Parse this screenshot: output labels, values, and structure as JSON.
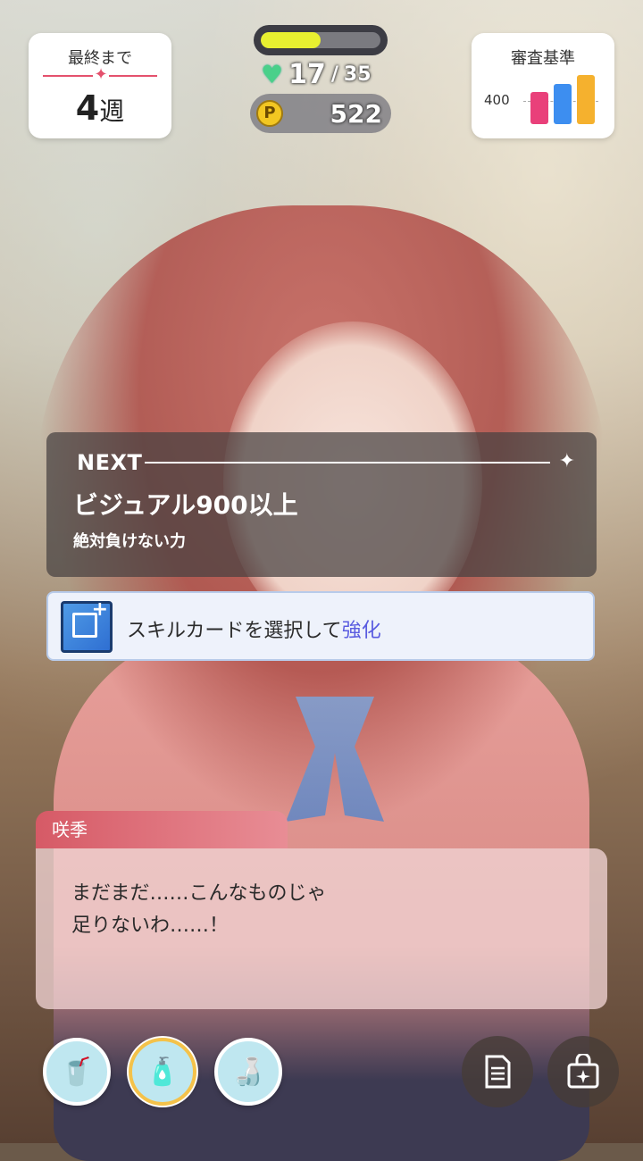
{
  "hud": {
    "weeks_left_label": "最終まで",
    "weeks_left_value": "4",
    "weeks_left_unit": "週",
    "stamina_fill": 0.5,
    "hp_current": "17",
    "hp_max": "35",
    "p_coin_symbol": "P",
    "p_points": "522",
    "criteria_label": "審査基準",
    "criteria_threshold": "400",
    "criteria_bars": [
      {
        "color": "#e9407a",
        "level": 0.62
      },
      {
        "color": "#3d8ef0",
        "level": 0.78
      },
      {
        "color": "#f5b12e",
        "level": 0.95
      }
    ]
  },
  "next_goal": {
    "tag": "NEXT",
    "star": "✦",
    "goal": "ビジュアル900以上",
    "subtitle": "絶対負けない力"
  },
  "skill_prompt": {
    "text": "スキルカードを選択して",
    "highlight": "強化",
    "icon": "skill-card-enhance-icon"
  },
  "dialogue": {
    "speaker": "咲季",
    "lines": [
      "まだまだ……こんなものじゃ",
      "足りないわ……！"
    ]
  },
  "items": [
    {
      "icon": "iced-coffee-icon",
      "glyph": "🥤",
      "selected": false
    },
    {
      "icon": "energy-drink-icon",
      "glyph": "🧴",
      "selected": true
    },
    {
      "icon": "oolong-tea-bottle-icon",
      "glyph": "🍶",
      "selected": false
    }
  ],
  "actions": [
    {
      "icon": "document-icon"
    },
    {
      "icon": "bag-icon"
    }
  ],
  "colors": {
    "accent_red": "#e4516d",
    "stamina": "#e8f030",
    "heart": "#4ad08a",
    "highlight": "#5a5ce0"
  }
}
